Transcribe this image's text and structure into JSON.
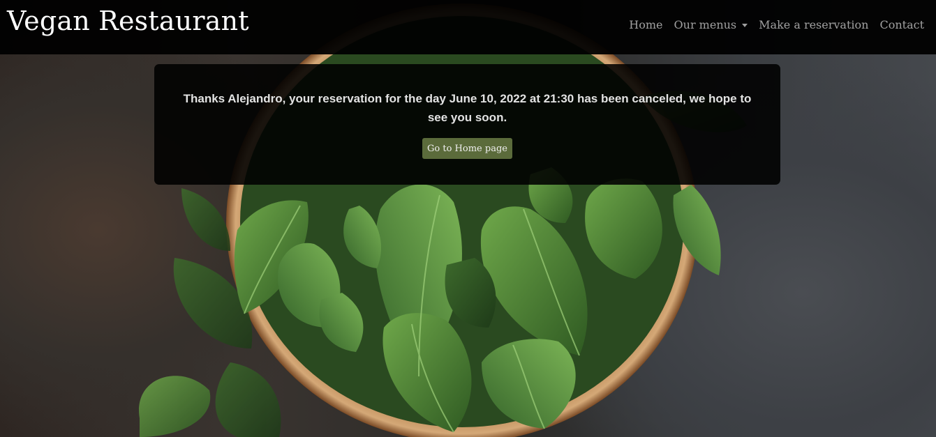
{
  "navbar": {
    "brand": "Vegan Restaurant",
    "links": [
      {
        "label": "Home"
      },
      {
        "label": "Our menus"
      },
      {
        "label": "Make a reservation"
      },
      {
        "label": "Contact"
      }
    ]
  },
  "card": {
    "message": "Thanks Alejandro, your reservation for the day June 10, 2022 at 21:30 has been canceled, we hope to see you soon.",
    "button_label": "Go to Home page"
  },
  "colors": {
    "navbar_bg": "#000000",
    "button_bg": "#5b6b3b",
    "card_bg": "#000000"
  },
  "icons": {
    "dropdown": "caret-down-icon"
  }
}
